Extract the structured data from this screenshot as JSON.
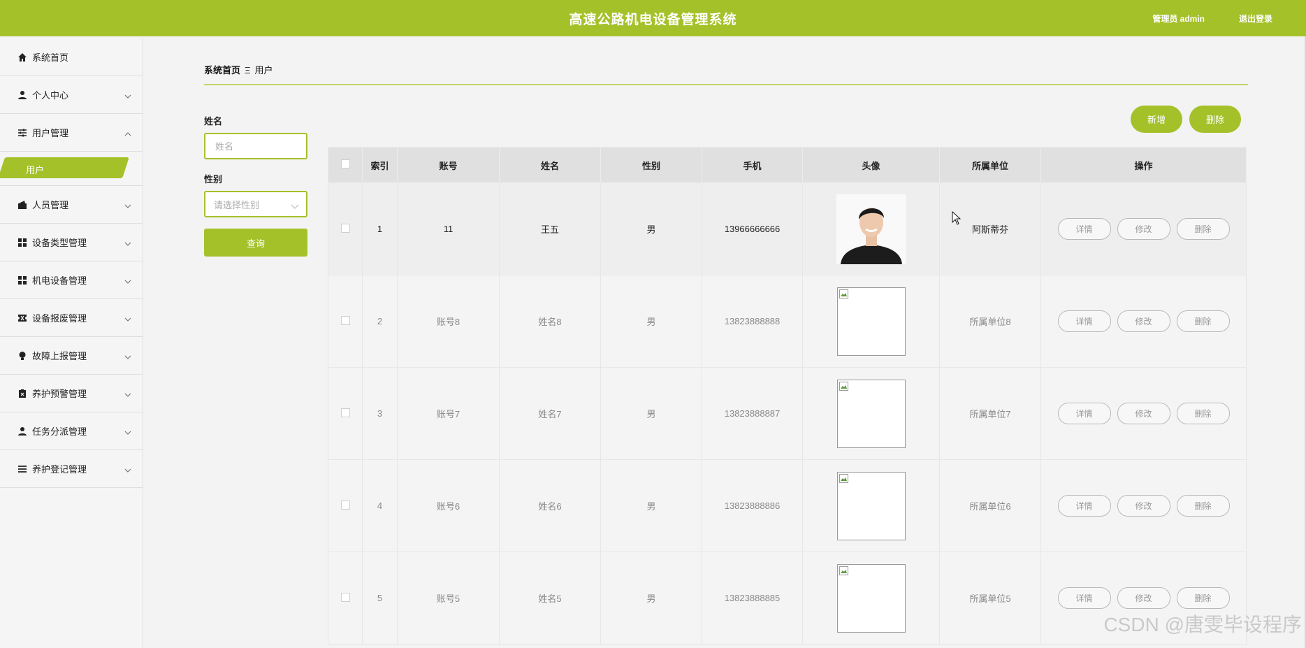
{
  "header": {
    "title": "高速公路机电设备管理系统",
    "admin": "管理员 admin",
    "logout": "退出登录"
  },
  "sidebar": {
    "items": [
      {
        "label": "系统首页",
        "icon": "home-icon"
      },
      {
        "label": "个人中心",
        "icon": "user-icon"
      },
      {
        "label": "用户管理",
        "icon": "sliders-icon"
      },
      {
        "label": "人员管理",
        "icon": "wallet-icon"
      },
      {
        "label": "设备类型管理",
        "icon": "grid-icon"
      },
      {
        "label": "机电设备管理",
        "icon": "grid-icon"
      },
      {
        "label": "设备报废管理",
        "icon": "ticket-icon"
      },
      {
        "label": "故障上报管理",
        "icon": "bulb-icon"
      },
      {
        "label": "养护预警管理",
        "icon": "clipboard-icon"
      },
      {
        "label": "任务分派管理",
        "icon": "user-icon"
      },
      {
        "label": "养护登记管理",
        "icon": "list-icon"
      }
    ],
    "sub_active": "用户"
  },
  "breadcrumb": {
    "home": "系统首页",
    "sep": "Ξ",
    "current": "用户"
  },
  "search": {
    "name_label": "姓名",
    "name_placeholder": "姓名",
    "gender_label": "性别",
    "gender_placeholder": "请选择性别",
    "query": "查询"
  },
  "actions": {
    "add": "新增",
    "delete": "删除"
  },
  "table": {
    "headers": [
      "索引",
      "账号",
      "姓名",
      "性别",
      "手机",
      "头像",
      "所属单位",
      "操作"
    ],
    "rows": [
      {
        "index": "1",
        "account": "11",
        "name": "王五",
        "gender": "男",
        "phone": "13966666666",
        "unit": "阿斯蒂芬"
      },
      {
        "index": "2",
        "account": "账号8",
        "name": "姓名8",
        "gender": "男",
        "phone": "13823888888",
        "unit": "所属单位8"
      },
      {
        "index": "3",
        "account": "账号7",
        "name": "姓名7",
        "gender": "男",
        "phone": "13823888887",
        "unit": "所属单位7"
      },
      {
        "index": "4",
        "account": "账号6",
        "name": "姓名6",
        "gender": "男",
        "phone": "13823888886",
        "unit": "所属单位6"
      },
      {
        "index": "5",
        "account": "账号5",
        "name": "姓名5",
        "gender": "男",
        "phone": "13823888885",
        "unit": "所属单位5"
      }
    ],
    "ops": {
      "detail": "详情",
      "edit": "修改",
      "delete": "删除"
    }
  },
  "watermark": "CSDN @唐雯毕设程序",
  "colors": {
    "accent": "#a5c12a"
  }
}
